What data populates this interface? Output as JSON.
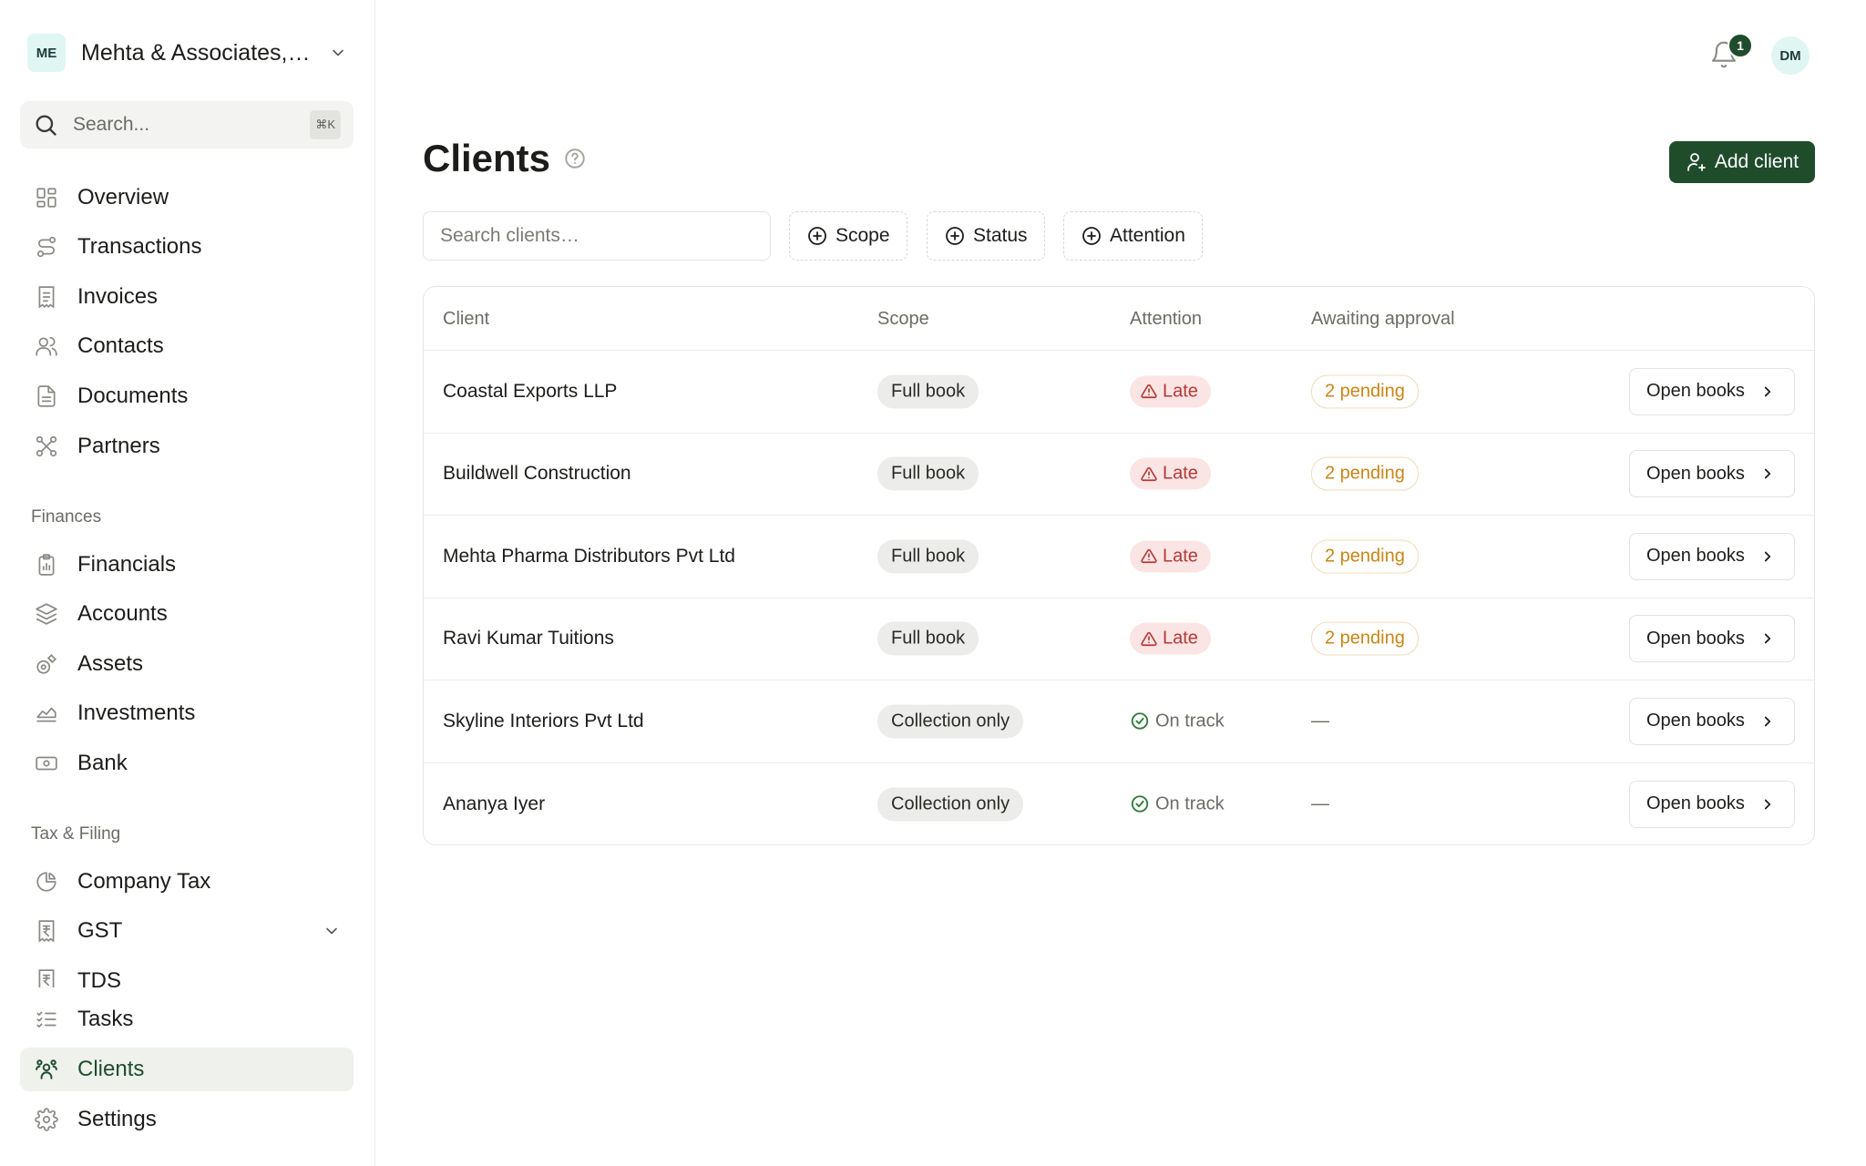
{
  "org": {
    "initials": "ME",
    "name": "Mehta & Associates,…"
  },
  "search": {
    "placeholder": "Search...",
    "shortcut": "⌘K"
  },
  "nav_main": [
    {
      "label": "Overview",
      "icon": "grid-icon"
    },
    {
      "label": "Transactions",
      "icon": "route-icon"
    },
    {
      "label": "Invoices",
      "icon": "receipt-icon"
    },
    {
      "label": "Contacts",
      "icon": "users-icon"
    },
    {
      "label": "Documents",
      "icon": "file-icon"
    },
    {
      "label": "Partners",
      "icon": "network-icon"
    }
  ],
  "finances": {
    "title": "Finances",
    "items": [
      {
        "label": "Financials",
        "icon": "clipboard-icon"
      },
      {
        "label": "Accounts",
        "icon": "layers-icon"
      },
      {
        "label": "Assets",
        "icon": "satellite-icon"
      },
      {
        "label": "Investments",
        "icon": "area-chart-icon"
      },
      {
        "label": "Bank",
        "icon": "banknote-icon"
      }
    ]
  },
  "tax": {
    "title": "Tax & Filing",
    "items": [
      {
        "label": "Company Tax",
        "icon": "pie-icon"
      },
      {
        "label": "GST",
        "icon": "rupee-receipt-icon"
      },
      {
        "label": "TDS",
        "icon": "rupee-receipt-icon"
      }
    ]
  },
  "nav_bottom": [
    {
      "label": "Tasks",
      "icon": "list-checks-icon"
    },
    {
      "label": "Clients",
      "icon": "users-group-icon"
    },
    {
      "label": "Settings",
      "icon": "gear-icon"
    }
  ],
  "header": {
    "notification_count": "1",
    "user_initials": "DM"
  },
  "page": {
    "title": "Clients",
    "add_label": "Add client"
  },
  "toolbar": {
    "search_placeholder": "Search clients…",
    "filters": [
      "Scope",
      "Status",
      "Attention"
    ]
  },
  "table": {
    "headers": [
      "Client",
      "Scope",
      "Attention",
      "Awaiting approval"
    ],
    "action_label": "Open books",
    "rows": [
      {
        "client": "Coastal Exports LLP",
        "scope": "Full book",
        "attention": "Late",
        "awaiting": "2 pending"
      },
      {
        "client": "Buildwell Construction",
        "scope": "Full book",
        "attention": "Late",
        "awaiting": "2 pending"
      },
      {
        "client": "Mehta Pharma Distributors Pvt Ltd",
        "scope": "Full book",
        "attention": "Late",
        "awaiting": "2 pending"
      },
      {
        "client": "Ravi Kumar Tuitions",
        "scope": "Full book",
        "attention": "Late",
        "awaiting": "2 pending"
      },
      {
        "client": "Skyline Interiors Pvt Ltd",
        "scope": "Collection only",
        "attention": "On track",
        "awaiting": "—"
      },
      {
        "client": "Ananya Iyer",
        "scope": "Collection only",
        "attention": "On track",
        "awaiting": "—"
      }
    ]
  },
  "colors": {
    "accent": "#1f4d2c",
    "late": "#b23a36",
    "pending": "#c98516",
    "on_track": "#2f7a3a"
  }
}
